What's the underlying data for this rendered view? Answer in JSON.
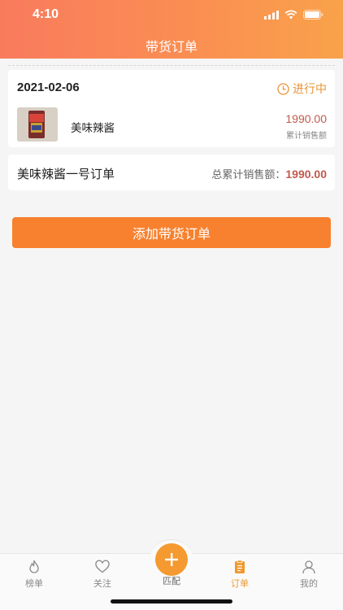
{
  "status_bar": {
    "time": "4:10"
  },
  "header": {
    "title": "带货订单"
  },
  "order_card": {
    "date": "2021-02-06",
    "status": "进行中",
    "product": {
      "name": "美味辣酱",
      "amount": "1990.00",
      "amount_label": "累计销售额"
    }
  },
  "summary": {
    "order_name": "美味辣酱一号订单",
    "total_label": "总累计销售额：",
    "total_amount": "1990.00"
  },
  "add_button": {
    "label": "添加带货订单"
  },
  "tabbar": {
    "tabs": [
      {
        "label": "榜单",
        "icon": "fire-icon"
      },
      {
        "label": "关注",
        "icon": "heart-icon"
      },
      {
        "label": "匹配",
        "icon": "plus-icon"
      },
      {
        "label": "订单",
        "icon": "clipboard-icon",
        "active": true
      },
      {
        "label": "我的",
        "icon": "person-icon"
      }
    ]
  },
  "colors": {
    "header_start": "#f97b5e",
    "header_end": "#f9a24a",
    "accent": "#f7812f",
    "amount": "#c05a4d",
    "status": "#e8953a"
  }
}
